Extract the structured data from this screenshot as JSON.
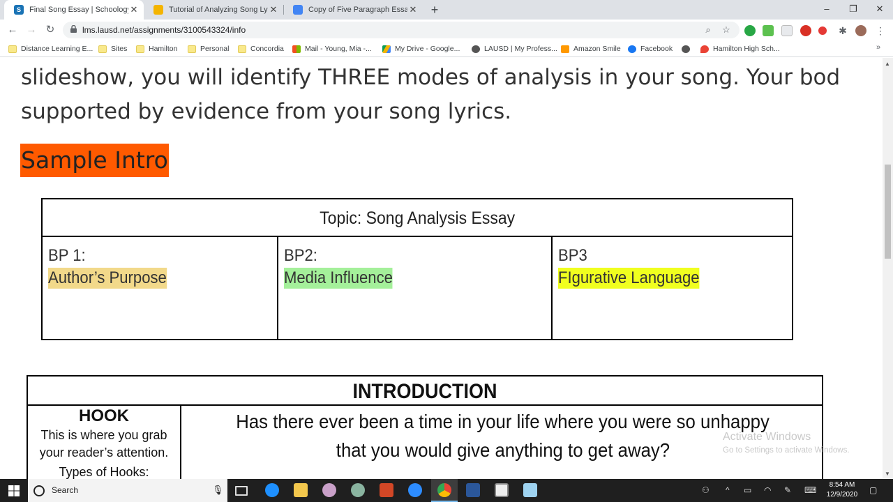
{
  "browser": {
    "tabs": [
      {
        "title": "Final Song Essay | Schoology",
        "favicon": "schoology-icon",
        "color": "#1a73b5",
        "active": true
      },
      {
        "title": "Tutorial of Analyzing Song Lyrics",
        "favicon": "slides-icon",
        "color": "#f4b400",
        "active": false
      },
      {
        "title": "Copy of Five Paragraph Essay For",
        "favicon": "docs-icon",
        "color": "#4285f4",
        "active": false
      }
    ],
    "new_tab_symbol": "+",
    "url": "lms.lausd.net/assignments/3100543324/info",
    "bookmarks": [
      {
        "label": "Distance Learning E...",
        "icon": "folder-icon"
      },
      {
        "label": "Sites",
        "icon": "folder-icon"
      },
      {
        "label": "Hamilton",
        "icon": "folder-icon"
      },
      {
        "label": "Personal",
        "icon": "folder-icon"
      },
      {
        "label": "Concordia",
        "icon": "folder-icon"
      },
      {
        "label": "Mail - Young, Mia -...",
        "icon": "microsoft-icon"
      },
      {
        "label": "My Drive - Google...",
        "icon": "google-drive-icon"
      },
      {
        "label": "LAUSD | My Profess...",
        "icon": "globe-icon"
      },
      {
        "label": "Amazon Smile",
        "icon": "amazon-icon"
      },
      {
        "label": "Facebook",
        "icon": "facebook-icon"
      },
      {
        "label": "",
        "icon": "globe-icon"
      },
      {
        "label": "Hamilton High Sch...",
        "icon": "maps-pin-icon"
      }
    ]
  },
  "page": {
    "paragraph_line1": "slideshow, you will identify THREE modes of analysis in your song. Your bod",
    "paragraph_line2": "supported by evidence from your song lyrics.",
    "sample_heading": "Sample Intro",
    "topic_table": {
      "header": "Topic: Song Analysis Essay",
      "columns": [
        {
          "label": "BP 1:",
          "value": "Author’s Purpose",
          "highlight": "#f2d98a"
        },
        {
          "label": "BP2:",
          "value": "Media Influence",
          "highlight": "#a4f09a"
        },
        {
          "label": "BP3",
          "value": "FIgurative Language",
          "highlight": "#f0ff1f"
        }
      ]
    },
    "intro_table": {
      "header": "INTRODUCTION",
      "hook_title": "HOOK",
      "hook_desc_line1": "This is where you grab",
      "hook_desc_line2": "your reader’s attention.",
      "hook_types": "Types of Hooks:",
      "hook_text_line1": "Has there ever been a time in your life where you were so unhappy",
      "hook_text_line2": "that you would give anything to get away?"
    },
    "watermark_line1": "Activate Windows",
    "watermark_line2": "Go to Settings to activate Windows."
  },
  "taskbar": {
    "search_label": "Search",
    "time": "8:54 AM",
    "date": "12/9/2020"
  }
}
